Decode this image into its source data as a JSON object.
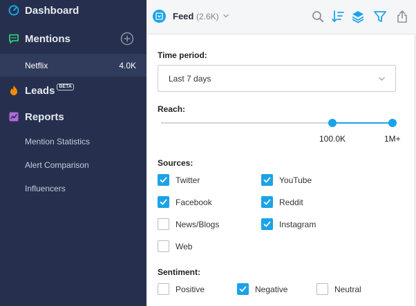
{
  "sidebar": {
    "dashboard_label": "Dashboard",
    "mentions_label": "Mentions",
    "project": {
      "name": "Netflix",
      "count": "4.0K"
    },
    "leads_label": "Leads",
    "leads_badge": "BETA",
    "reports_label": "Reports",
    "report_items": [
      "Mention Statistics",
      "Alert Comparison",
      "Influencers"
    ]
  },
  "header": {
    "title": "Feed",
    "count": "(2.6K)",
    "tools": [
      "search-icon",
      "sort-icon",
      "layers-icon",
      "filter-icon",
      "share-icon"
    ]
  },
  "filters": {
    "time_period": {
      "label": "Time period:",
      "value": "Last 7 days"
    },
    "reach": {
      "label": "Reach:",
      "min_label": "100.0K",
      "max_label": "1M+",
      "range_fraction": [
        0.74,
        1.0
      ]
    },
    "sources": {
      "label": "Sources:",
      "items": [
        {
          "label": "Twitter",
          "checked": true
        },
        {
          "label": "YouTube",
          "checked": true
        },
        {
          "label": "Facebook",
          "checked": true
        },
        {
          "label": "Reddit",
          "checked": true
        },
        {
          "label": "News/Blogs",
          "checked": false
        },
        {
          "label": "Instagram",
          "checked": true
        },
        {
          "label": "Web",
          "checked": false
        }
      ]
    },
    "sentiment": {
      "label": "Sentiment:",
      "items": [
        {
          "label": "Positive",
          "checked": false
        },
        {
          "label": "Negative",
          "checked": true
        },
        {
          "label": "Neutral",
          "checked": false
        }
      ]
    }
  },
  "colors": {
    "sidebar": "#26304e",
    "accent": "#1aa3e8",
    "mentions_icon": "#2ecc71",
    "leads_icon": "#ff8a00",
    "reports_icon": "#b06ad9"
  }
}
